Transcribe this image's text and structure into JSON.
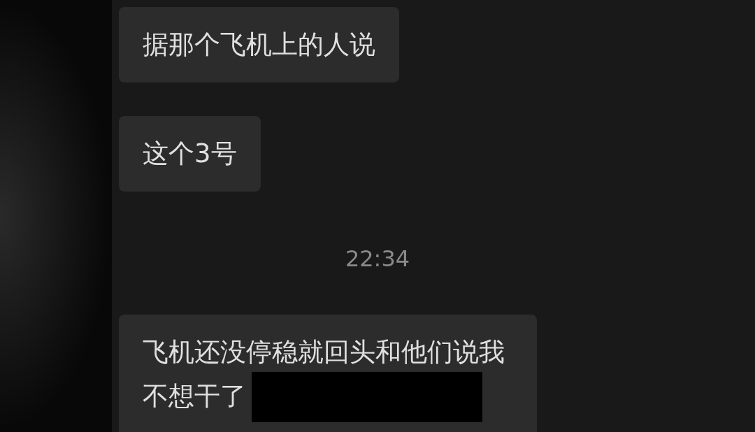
{
  "messages": [
    {
      "kind": "bubble",
      "text": "据那个飞机上的人说"
    },
    {
      "kind": "bubble",
      "text": "这个3号"
    },
    {
      "kind": "time",
      "text": "22:34"
    },
    {
      "kind": "bubble",
      "text": "飞机还没停稳就回头和他们说我不想干了",
      "redacted": true
    }
  ]
}
